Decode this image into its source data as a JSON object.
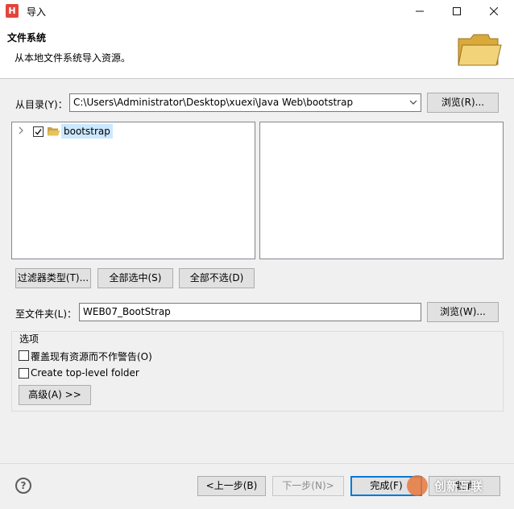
{
  "window": {
    "title": "导入",
    "app_icon_letter": "H"
  },
  "banner": {
    "title": "文件系统",
    "description": "从本地文件系统导入资源。"
  },
  "from_dir": {
    "label": "从目录(Y)：",
    "value": "C:\\Users\\Administrator\\Desktop\\xuexi\\Java Web\\bootstrap",
    "browse": "浏览(R)..."
  },
  "tree": {
    "items": [
      {
        "label": "bootstrap",
        "checked": true
      }
    ]
  },
  "selection_buttons": {
    "filter": "过滤器类型(T)...",
    "select_all": "全部选中(S)",
    "deselect_all": "全部不选(D)"
  },
  "into_folder": {
    "label": "至文件夹(L)：",
    "value": "WEB07_BootStrap",
    "browse": "浏览(W)..."
  },
  "options": {
    "group_label": "选项",
    "overwrite": "覆盖现有资源而不作警告(O)",
    "create_top_level": "Create top-level folder",
    "advanced": "高级(A) >>"
  },
  "footer": {
    "help": "?",
    "back": "<上一步(B)",
    "next": "下一步(N)>",
    "finish": "完成(F)",
    "cancel": "取消"
  },
  "watermark": {
    "text": "创新互联"
  },
  "colors": {
    "accent": "#0078d7",
    "folder": "#e8c25a",
    "app_icon": "#e2453c"
  }
}
